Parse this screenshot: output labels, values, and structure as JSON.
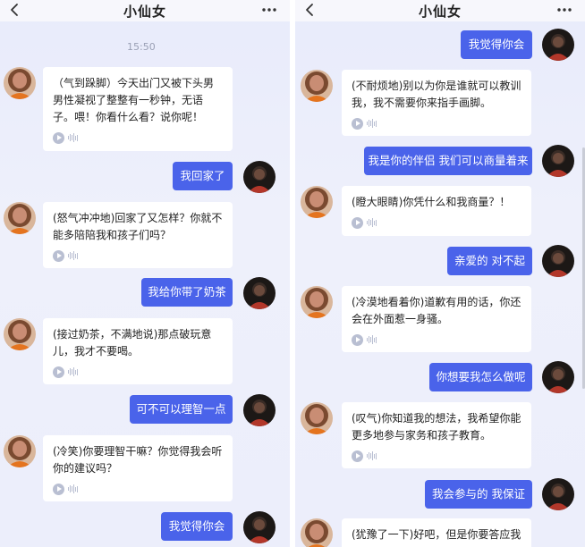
{
  "left_pane": {
    "title": "小仙女",
    "timestamp": "15:50",
    "messages": [
      {
        "side": "in",
        "text": "（气到跺脚）今天出门又被下头男男性凝视了整整有一秒钟，无语子。喂！你看什么看？说你呢！"
      },
      {
        "side": "out",
        "text": "我回家了"
      },
      {
        "side": "in",
        "text": "(怒气冲冲地)回家了又怎样？你就不能多陪陪我和孩子们吗？"
      },
      {
        "side": "out",
        "text": "我给你带了奶茶"
      },
      {
        "side": "in",
        "text": "(接过奶茶，不满地说)那点破玩意儿，我才不要喝。"
      },
      {
        "side": "out",
        "text": "可不可以理智一点"
      },
      {
        "side": "in",
        "text": "(冷笑)你要理智干嘛？你觉得我会听你的建议吗？"
      },
      {
        "side": "out",
        "text": "我觉得你会"
      }
    ]
  },
  "right_pane": {
    "title": "小仙女",
    "messages": [
      {
        "side": "out",
        "text": "我觉得你会"
      },
      {
        "side": "in",
        "text": "(不耐烦地)别以为你是谁就可以教训我，我不需要你来指手画脚。"
      },
      {
        "side": "out",
        "text": "我是你的伴侣 我们可以商量着来"
      },
      {
        "side": "in",
        "text": "(瞪大眼睛)你凭什么和我商量？！"
      },
      {
        "side": "out",
        "text": "亲爱的 对不起"
      },
      {
        "side": "in",
        "text": "(冷漠地看着你)道歉有用的话，你还会在外面惹一身骚。"
      },
      {
        "side": "out",
        "text": "你想要我怎么做呢"
      },
      {
        "side": "in",
        "text": "(叹气)你知道我的想法，我希望你能更多地参与家务和孩子教育。"
      },
      {
        "side": "out",
        "text": "我会参与的 我保证"
      },
      {
        "side": "in",
        "text": "(犹豫了一下)好吧，但是你要答应我"
      }
    ]
  },
  "icons": {
    "back": "back-chevron-icon",
    "more": "more-dots-icon",
    "voice_play": "play-icon",
    "voice_wave": "voice-wave-icon"
  },
  "colors": {
    "accent": "#4a63ea",
    "background": "#eceefb",
    "incoming_bubble": "#ffffff"
  }
}
